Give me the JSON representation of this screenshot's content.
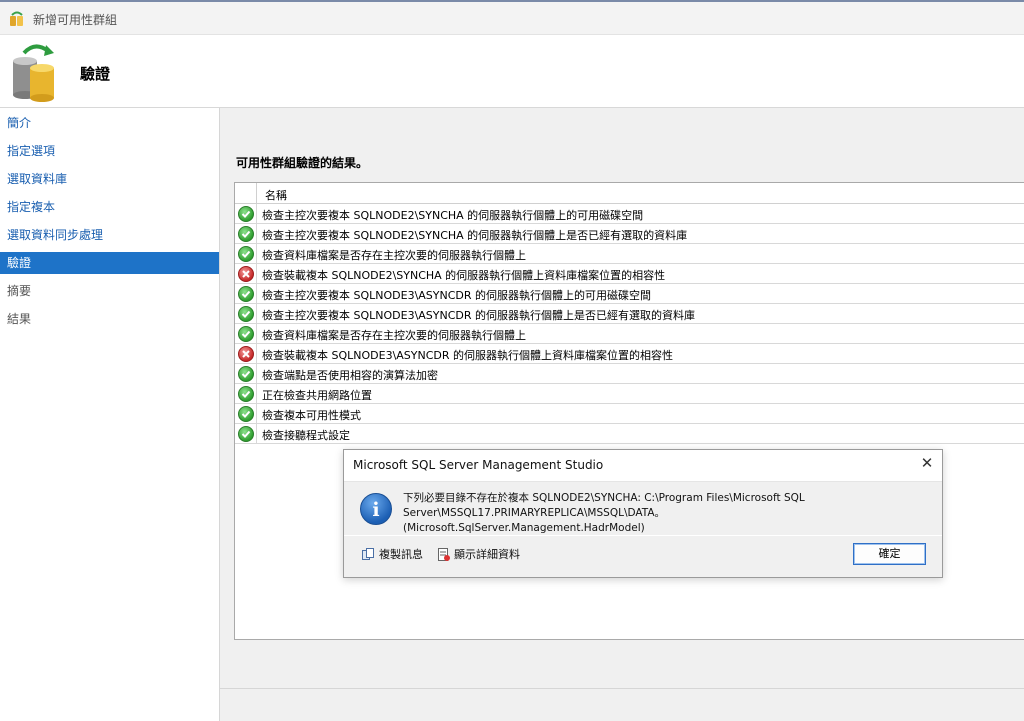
{
  "window": {
    "title": "新增可用性群組",
    "icon": "availability-group-icon"
  },
  "banner": {
    "heading": "驗證",
    "icon": "database-sync-icon"
  },
  "sidebar": {
    "items": [
      {
        "label": "簡介",
        "state": "link"
      },
      {
        "label": "指定選項",
        "state": "link"
      },
      {
        "label": "選取資料庫",
        "state": "link"
      },
      {
        "label": "指定複本",
        "state": "link"
      },
      {
        "label": "選取資料同步處理",
        "state": "link"
      },
      {
        "label": "驗證",
        "state": "active"
      },
      {
        "label": "摘要",
        "state": "disabled"
      },
      {
        "label": "結果",
        "state": "disabled"
      }
    ]
  },
  "main": {
    "results_label": "可用性群組驗證的結果。",
    "grid": {
      "column_name": "名稱",
      "rows": [
        {
          "status": "success",
          "icon": "success-check-icon",
          "text": "檢查主控次要複本 SQLNODE2\\SYNCHA 的伺服器執行個體上的可用磁碟空間"
        },
        {
          "status": "success",
          "icon": "success-check-icon",
          "text": "檢查主控次要複本 SQLNODE2\\SYNCHA 的伺服器執行個體上是否已經有選取的資料庫"
        },
        {
          "status": "success",
          "icon": "success-check-icon",
          "text": "檢查資料庫檔案是否存在主控次要的伺服器執行個體上"
        },
        {
          "status": "error",
          "icon": "error-x-icon",
          "text": "檢查裝載複本 SQLNODE2\\SYNCHA 的伺服器執行個體上資料庫檔案位置的相容性"
        },
        {
          "status": "success",
          "icon": "success-check-icon",
          "text": "檢查主控次要複本 SQLNODE3\\ASYNCDR 的伺服器執行個體上的可用磁碟空間"
        },
        {
          "status": "success",
          "icon": "success-check-icon",
          "text": "檢查主控次要複本 SQLNODE3\\ASYNCDR 的伺服器執行個體上是否已經有選取的資料庫"
        },
        {
          "status": "success",
          "icon": "success-check-icon",
          "text": "檢查資料庫檔案是否存在主控次要的伺服器執行個體上"
        },
        {
          "status": "error",
          "icon": "error-x-icon",
          "text": "檢查裝載複本 SQLNODE3\\ASYNCDR 的伺服器執行個體上資料庫檔案位置的相容性"
        },
        {
          "status": "success",
          "icon": "success-check-icon",
          "text": "檢查端點是否使用相容的演算法加密"
        },
        {
          "status": "success",
          "icon": "success-check-icon",
          "text": "正在檢查共用網路位置"
        },
        {
          "status": "success",
          "icon": "success-check-icon",
          "text": "檢查複本可用性模式"
        },
        {
          "status": "success",
          "icon": "success-check-icon",
          "text": "檢查接聽程式設定"
        }
      ]
    }
  },
  "dialog": {
    "title": "Microsoft SQL Server Management Studio",
    "icon": "info-icon",
    "message_line1": "下列必要目錄不存在於複本 SQLNODE2\\SYNCHA: C:\\Program Files\\Microsoft SQL",
    "message_line2": "Server\\MSSQL17.PRIMARYREPLICA\\MSSQL\\DATA。 (Microsoft.SqlServer.Management.HadrModel)",
    "copy_label": "複製訊息",
    "details_label": "顯示詳細資料",
    "ok_label": "確定",
    "close_label": "✕"
  },
  "colors": {
    "accent": "#1e73c8",
    "link": "#1a5fb0",
    "success": "#2f9e2f",
    "error": "#c62828"
  }
}
